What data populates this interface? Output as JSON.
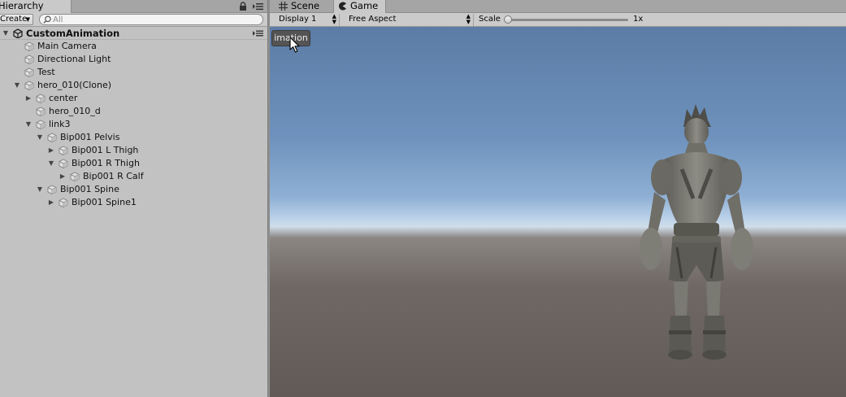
{
  "hierarchy": {
    "tab_label": "Hierarchy",
    "create_label": "Create",
    "search_placeholder": "All",
    "scene_name": "CustomAnimation",
    "items": [
      {
        "label": "Main Camera",
        "depth": 1,
        "arrow": ""
      },
      {
        "label": "Directional Light",
        "depth": 1,
        "arrow": ""
      },
      {
        "label": "Test",
        "depth": 1,
        "arrow": ""
      },
      {
        "label": "hero_010(Clone)",
        "depth": 1,
        "arrow": "expanded"
      },
      {
        "label": "center",
        "depth": 2,
        "arrow": "collapsed"
      },
      {
        "label": "hero_010_d",
        "depth": 2,
        "arrow": ""
      },
      {
        "label": "link3",
        "depth": 2,
        "arrow": "expanded"
      },
      {
        "label": "Bip001 Pelvis",
        "depth": 3,
        "arrow": "expanded"
      },
      {
        "label": "Bip001 L Thigh",
        "depth": 4,
        "arrow": "collapsed"
      },
      {
        "label": "Bip001 R Thigh",
        "depth": 4,
        "arrow": "expanded"
      },
      {
        "label": "Bip001 R Calf",
        "depth": 5,
        "arrow": "collapsed"
      },
      {
        "label": "Bip001 Spine",
        "depth": 3,
        "arrow": "expanded"
      },
      {
        "label": "Bip001 Spine1",
        "depth": 4,
        "arrow": "collapsed"
      }
    ]
  },
  "game": {
    "tabs": [
      {
        "label": "Scene",
        "icon": "grid-icon",
        "active": false
      },
      {
        "label": "Game",
        "icon": "pacman-icon",
        "active": true
      }
    ],
    "display_label": "Display 1",
    "aspect_label": "Free Aspect",
    "scale_label": "Scale",
    "scale_value": "1x",
    "scale_fraction": 0.0,
    "overlay_button_label": "imation"
  },
  "colors": {
    "panel_bg": "#c2c2c2",
    "toolbar_bg": "#cbcbcb",
    "sky_top": "#5b7ca5",
    "horizon": "#cfdde9",
    "ground": "#615a57",
    "hero": "#7b7a72"
  }
}
